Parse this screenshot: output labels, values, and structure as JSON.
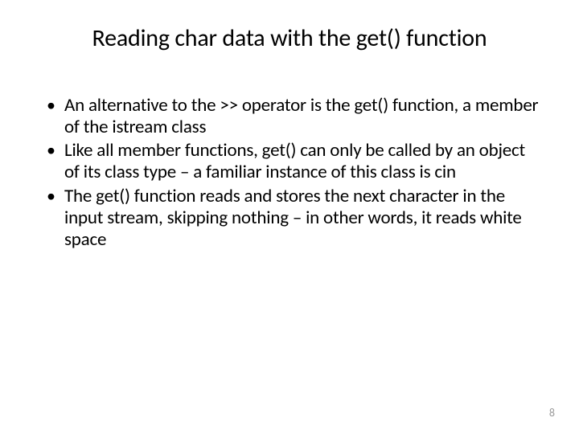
{
  "title": "Reading char data with the get() function",
  "bullets": [
    "An alternative to the >> operator is the get() function, a member of the istream class",
    "Like all member functions, get() can only be called by an object of its class type – a familiar instance of this class is cin",
    "The get() function reads and stores the next character in the input stream, skipping nothing – in other words, it reads white space"
  ],
  "page_number": "8"
}
